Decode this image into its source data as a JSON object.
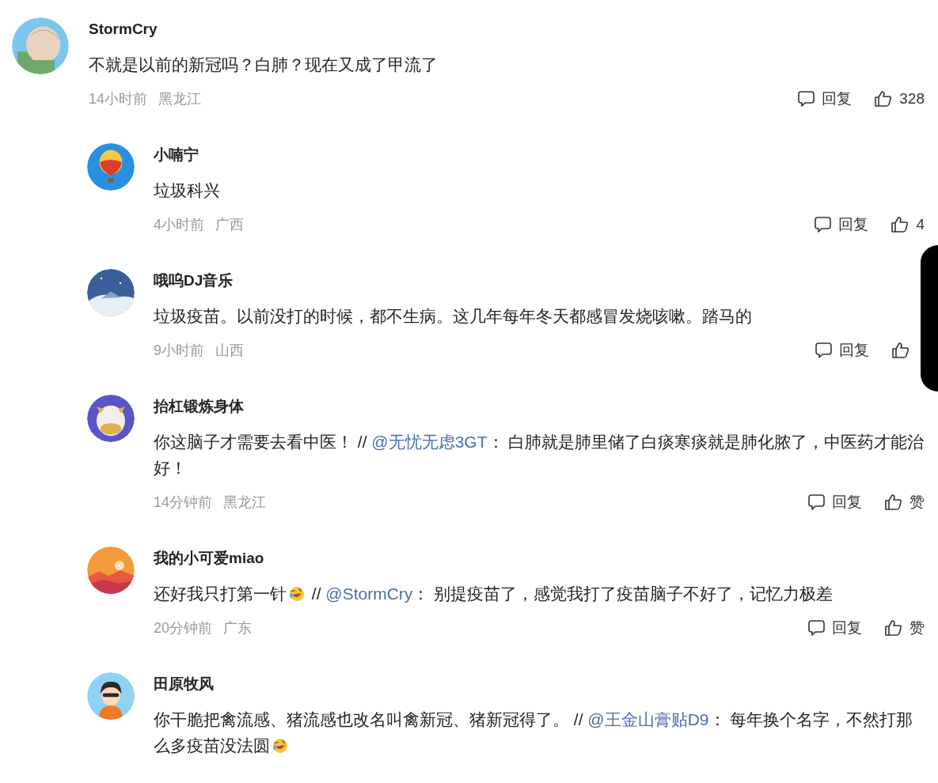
{
  "comments": [
    {
      "user": "StormCry",
      "body": [
        {
          "kind": "text",
          "text": "不就是以前的新冠吗？白肺？现在又成了甲流了"
        }
      ],
      "time": "14小时前",
      "location": "黑龙江",
      "reply_label": "回复",
      "likes": "328",
      "replies": [
        {
          "user": "小喃宁",
          "body": [
            {
              "kind": "text",
              "text": "垃圾科兴"
            }
          ],
          "time": "4小时前",
          "location": "广西",
          "reply_label": "回复",
          "likes": "4"
        },
        {
          "user": "哦呜DJ音乐",
          "body": [
            {
              "kind": "text",
              "text": "垃圾疫苗。以前没打的时候，都不生病。这几年每年冬天都感冒发烧咳嗽。踏马的"
            }
          ],
          "time": "9小时前",
          "location": "山西",
          "reply_label": "回复"
        },
        {
          "user": "抬杠锻炼身体",
          "body": [
            {
              "kind": "text",
              "text": "你这脑子才需要去看中医！ // "
            },
            {
              "kind": "mention",
              "text": "@无忧无虑3GT"
            },
            {
              "kind": "text",
              "text": "： 白肺就是肺里储了白痰寒痰就是肺化脓了，中医药才能治好！"
            }
          ],
          "time": "14分钟前",
          "location": "黑龙江",
          "reply_label": "回复",
          "likes": "赞"
        },
        {
          "user": "我的小可爱miao",
          "body": [
            {
              "kind": "text",
              "text": "还好我只打第一针"
            },
            {
              "kind": "emoji"
            },
            {
              "kind": "text",
              "text": " // "
            },
            {
              "kind": "mention",
              "text": "@StormCry"
            },
            {
              "kind": "text",
              "text": "： 别提疫苗了，感觉我打了疫苗脑子不好了，记忆力极差"
            }
          ],
          "time": "20分钟前",
          "location": "广东",
          "reply_label": "回复",
          "likes": "赞"
        },
        {
          "user": "田原牧风",
          "body": [
            {
              "kind": "text",
              "text": "你干脆把禽流感、猪流感也改名叫禽新冠、猪新冠得了。 // "
            },
            {
              "kind": "mention",
              "text": "@王金山膏贴D9"
            },
            {
              "kind": "text",
              "text": "： 每年换个名字，不然打那么多疫苗没法圆"
            },
            {
              "kind": "emoji"
            }
          ]
        }
      ]
    }
  ]
}
